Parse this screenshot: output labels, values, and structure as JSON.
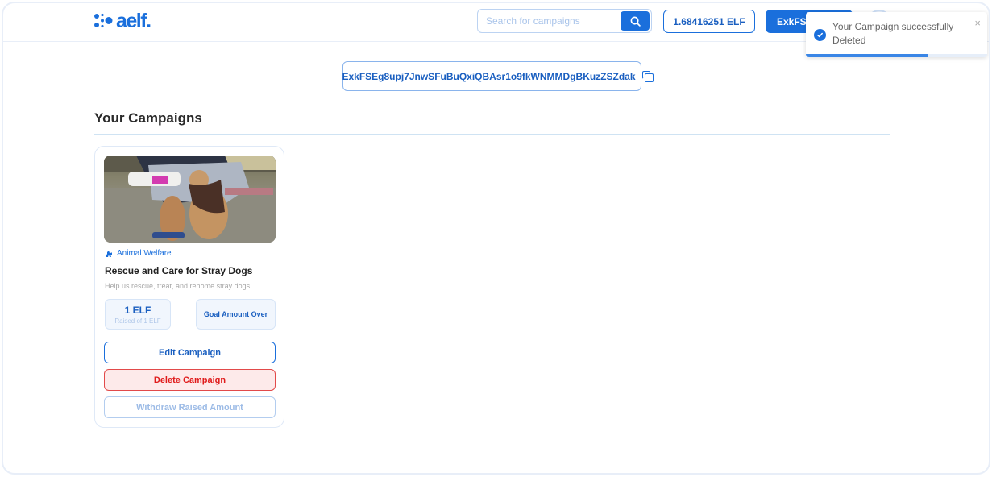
{
  "header": {
    "logo_text": "aelf.",
    "search_placeholder": "Search for campaigns",
    "search_value": "",
    "balance": "1.68416251 ELF",
    "wallet_button": "ExkFS...",
    "icons": {
      "search": "search-icon",
      "logo": "aelf-dots-icon",
      "avatar": "avatar-icon"
    }
  },
  "address": {
    "value": "ExkFSEg8upj7JnwSFuBuQxiQBAsr1o9fkWNMMDgBKuzZSZdak",
    "icon": "copy-icon"
  },
  "section": {
    "title": "Your Campaigns"
  },
  "campaigns": [
    {
      "image_alt": "Person bottle-feeding puppies",
      "category": "Animal Welfare",
      "category_icon": "dog-icon",
      "title": "Rescue and Care for Stray Dogs",
      "description": "Help us rescue, treat, and rehome stray dogs ...",
      "raised_value": "1 ELF",
      "raised_sub": "Raised of 1 ELF",
      "goal_status": "Goal Amount Over",
      "buttons": {
        "edit": "Edit Campaign",
        "delete": "Delete Campaign",
        "withdraw": "Withdraw Raised Amount"
      }
    }
  ],
  "toast": {
    "message": "Your Campaign successfully Deleted",
    "icon": "check-circle-icon",
    "close": "×",
    "progress_percent": 67,
    "colors": {
      "accent": "#1a6fdc"
    }
  },
  "colors": {
    "brand": "#1a6fdc",
    "danger": "#e01b1b",
    "danger_bg": "#fdeaea"
  }
}
